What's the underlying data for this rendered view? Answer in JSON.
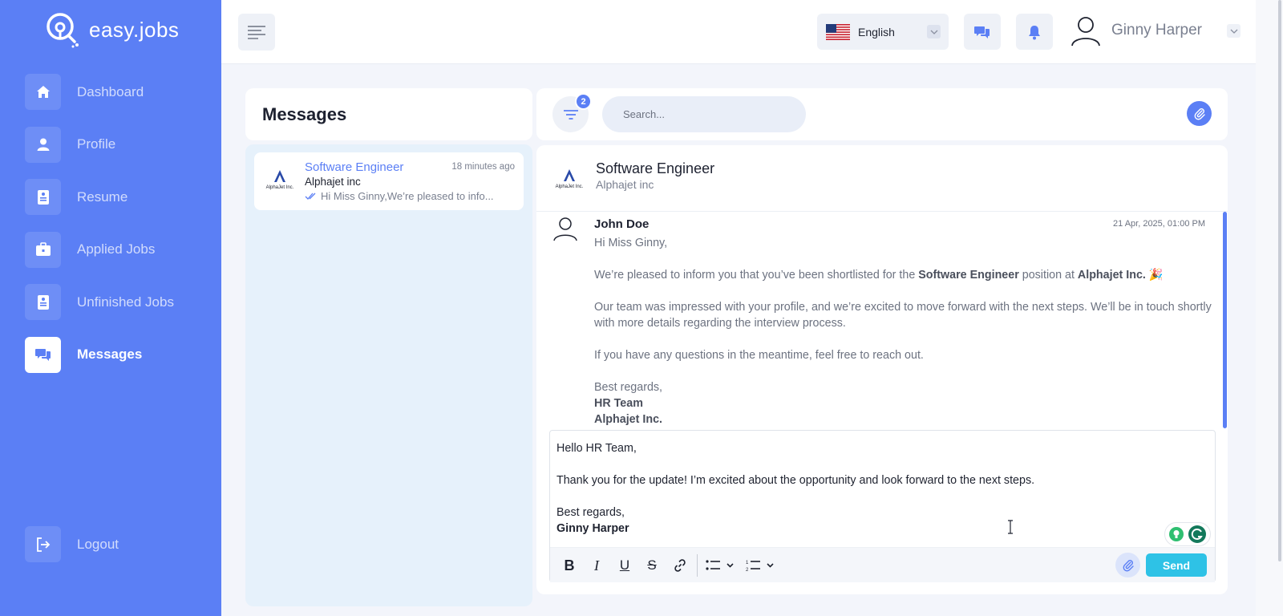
{
  "app": {
    "logo_text": "easy.jobs"
  },
  "sidebar": {
    "items": [
      {
        "label": "Dashboard",
        "icon": "home-icon"
      },
      {
        "label": "Profile",
        "icon": "user-icon"
      },
      {
        "label": "Resume",
        "icon": "resume-icon"
      },
      {
        "label": "Applied Jobs",
        "icon": "briefcase-icon"
      },
      {
        "label": "Unfinished Jobs",
        "icon": "document-icon"
      },
      {
        "label": "Messages",
        "icon": "chat-icon",
        "active": true
      }
    ],
    "logout_label": "Logout"
  },
  "topbar": {
    "language": "English",
    "user_name": "Ginny Harper"
  },
  "messages_panel": {
    "title": "Messages",
    "filter_count": "2",
    "search_placeholder": "Search...",
    "conversations": [
      {
        "title": "Software Engineer",
        "time": "18 minutes ago",
        "company": "Alphajet inc",
        "preview": "Hi Miss Ginny,We’re pleased to info...",
        "logo_text": "AlphaJet Inc."
      }
    ]
  },
  "conversation": {
    "title": "Software Engineer",
    "subtitle": "Alphajet inc",
    "message": {
      "sender": "John Doe",
      "date": "21 Apr, 2025, 01:00 PM",
      "greeting": "Hi Miss Ginny,",
      "p1_start": "We’re pleased to inform you that you’ve been shortlisted for the ",
      "p1_role": "Software Engineer",
      "p1_mid": " position at ",
      "p1_company": "Alphajet Inc.",
      "p1_emoji": "🎉",
      "p2": "Our team was impressed with your profile, and we’re excited to move forward with the next steps. We’ll be in touch shortly with more details regarding the interview process.",
      "p3": "If you have any questions in the meantime, feel free to reach out.",
      "signoff": "Best regards,",
      "sig1": "HR Team",
      "sig2": "Alphajet Inc."
    }
  },
  "composer": {
    "line1": "Hello HR Team,",
    "line2": "Thank you for the update! I’m excited about the opportunity and look forward to the next steps.",
    "line3": "Best regards,",
    "line4": "Ginny Harper",
    "send_label": "Send"
  },
  "colors": {
    "primary": "#5b7ff5",
    "send": "#2ec2e6",
    "list_bg": "#e6f1fb"
  }
}
